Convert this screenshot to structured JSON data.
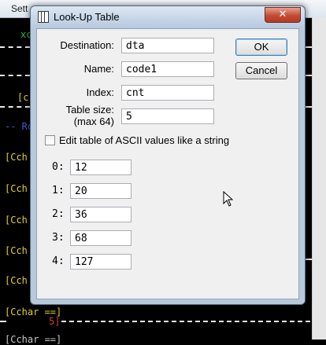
{
  "background": {
    "menubar_partial": "Sett",
    "code_lines": [
      {
        "text": "xc",
        "color": "green"
      },
      {
        "text": "[cr",
        "color": "yellow"
      },
      {
        "text": "-- Ro",
        "color": "blue"
      },
      {
        "text": "[Cch",
        "color": "yellow"
      },
      {
        "text": "[Cch",
        "color": "yellow"
      },
      {
        "text": "[Cch",
        "color": "yellow"
      },
      {
        "text": "[Cch",
        "color": "yellow"
      },
      {
        "text": "[Cch",
        "color": "yellow"
      },
      {
        "text": "[Cchar ==]",
        "color": "yellow"
      },
      {
        "text": "5]",
        "color": "red"
      },
      {
        "text": "[Cchar ==]",
        "color": "gray"
      }
    ]
  },
  "dialog": {
    "title": "Look-Up Table",
    "close_symbol": "✕",
    "destination": {
      "label": "Destination:",
      "value": "dta"
    },
    "name": {
      "label": "Name:",
      "value": "code1"
    },
    "index": {
      "label": "Index:",
      "value": "cnt"
    },
    "table_size": {
      "label_line1": "Table size:",
      "label_line2": "(max 64)",
      "value": "5"
    },
    "ok_label": "OK",
    "cancel_label": "Cancel",
    "ascii_checkbox": {
      "label": "Edit table of ASCII values like a string",
      "checked": false
    },
    "rows": [
      {
        "label": "0:",
        "value": "12"
      },
      {
        "label": "1:",
        "value": "20"
      },
      {
        "label": "2:",
        "value": "36"
      },
      {
        "label": "3:",
        "value": "68"
      },
      {
        "label": "4:",
        "value": "127"
      }
    ]
  }
}
